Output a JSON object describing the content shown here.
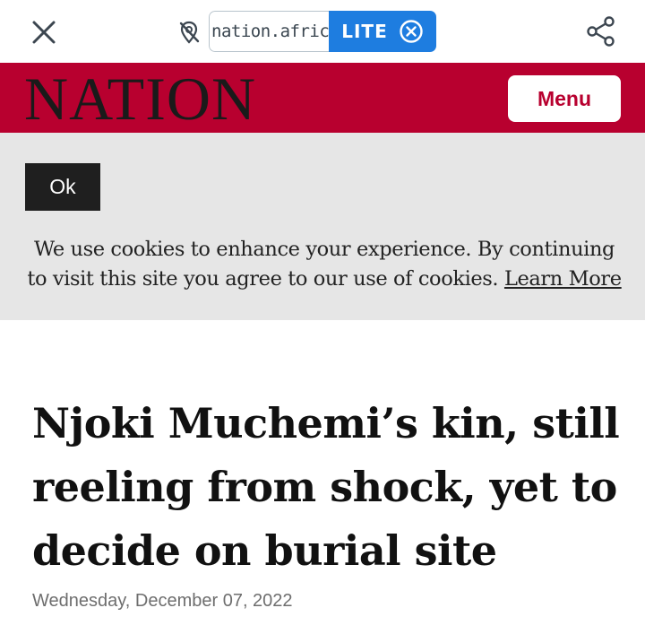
{
  "browser": {
    "url_text": "nation.africa",
    "lite_label": "LITE",
    "icons": {
      "close": "close-icon",
      "location_off": "location-off-icon",
      "lite_close": "circle-x-icon",
      "share": "share-icon"
    },
    "accent_color": "#1e7de0"
  },
  "site": {
    "logo_text": "NATION",
    "menu_label": "Menu",
    "brand_color": "#b8002f"
  },
  "cookie_banner": {
    "ok_label": "Ok",
    "message": "We use cookies to enhance your experience. By continuing to visit this site you agree to our use of cookies.",
    "learn_more_label": "Learn More"
  },
  "article": {
    "headline": "Njoki Muchemi’s kin, still reeling from shock, yet to decide on burial site",
    "date": "Wednesday, December 07, 2022"
  }
}
